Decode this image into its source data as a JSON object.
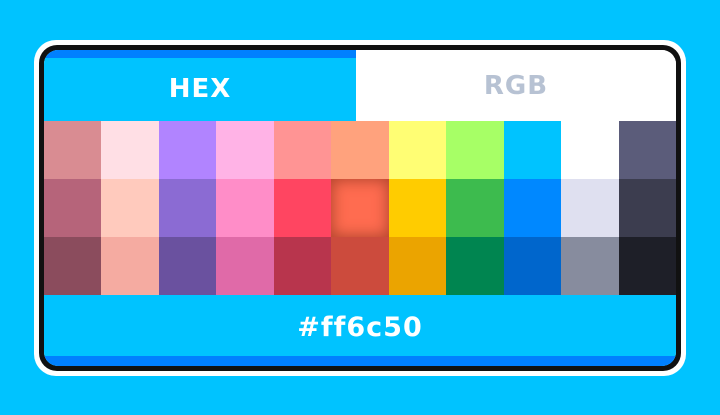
{
  "tabs": {
    "hex_label": "HEX",
    "rgb_label": "RGB",
    "active": "HEX"
  },
  "palette": {
    "rows": [
      [
        "#d98c92",
        "#ffdfe5",
        "#b184ff",
        "#ffb3e6",
        "#ff9494",
        "#ffa27d",
        "#fffe74",
        "#a7ff66",
        "#00c3ff",
        "#ffffff",
        "#5b5c7a"
      ],
      [
        "#b6647a",
        "#ffcabd",
        "#8b6bd3",
        "#ff8dc8",
        "#ff4561",
        "#ff6c50",
        "#ffcc00",
        "#3dbb4e",
        "#0088ff",
        "#dfe0f0",
        "#3c3d4f"
      ],
      [
        "#8b4c5d",
        "#f5aba1",
        "#6a519f",
        "#e06aa8",
        "#b8354d",
        "#cc4b3d",
        "#eba400",
        "#008550",
        "#0066cc",
        "#878c9e",
        "#1e1f28"
      ]
    ],
    "selected_row": 1,
    "selected_col": 5
  },
  "selected_value": "#ff6c50",
  "colors": {
    "background": "#00c3ff",
    "accent_dark": "#0080ff",
    "tab_inactive_text": "#b7c2d3"
  }
}
